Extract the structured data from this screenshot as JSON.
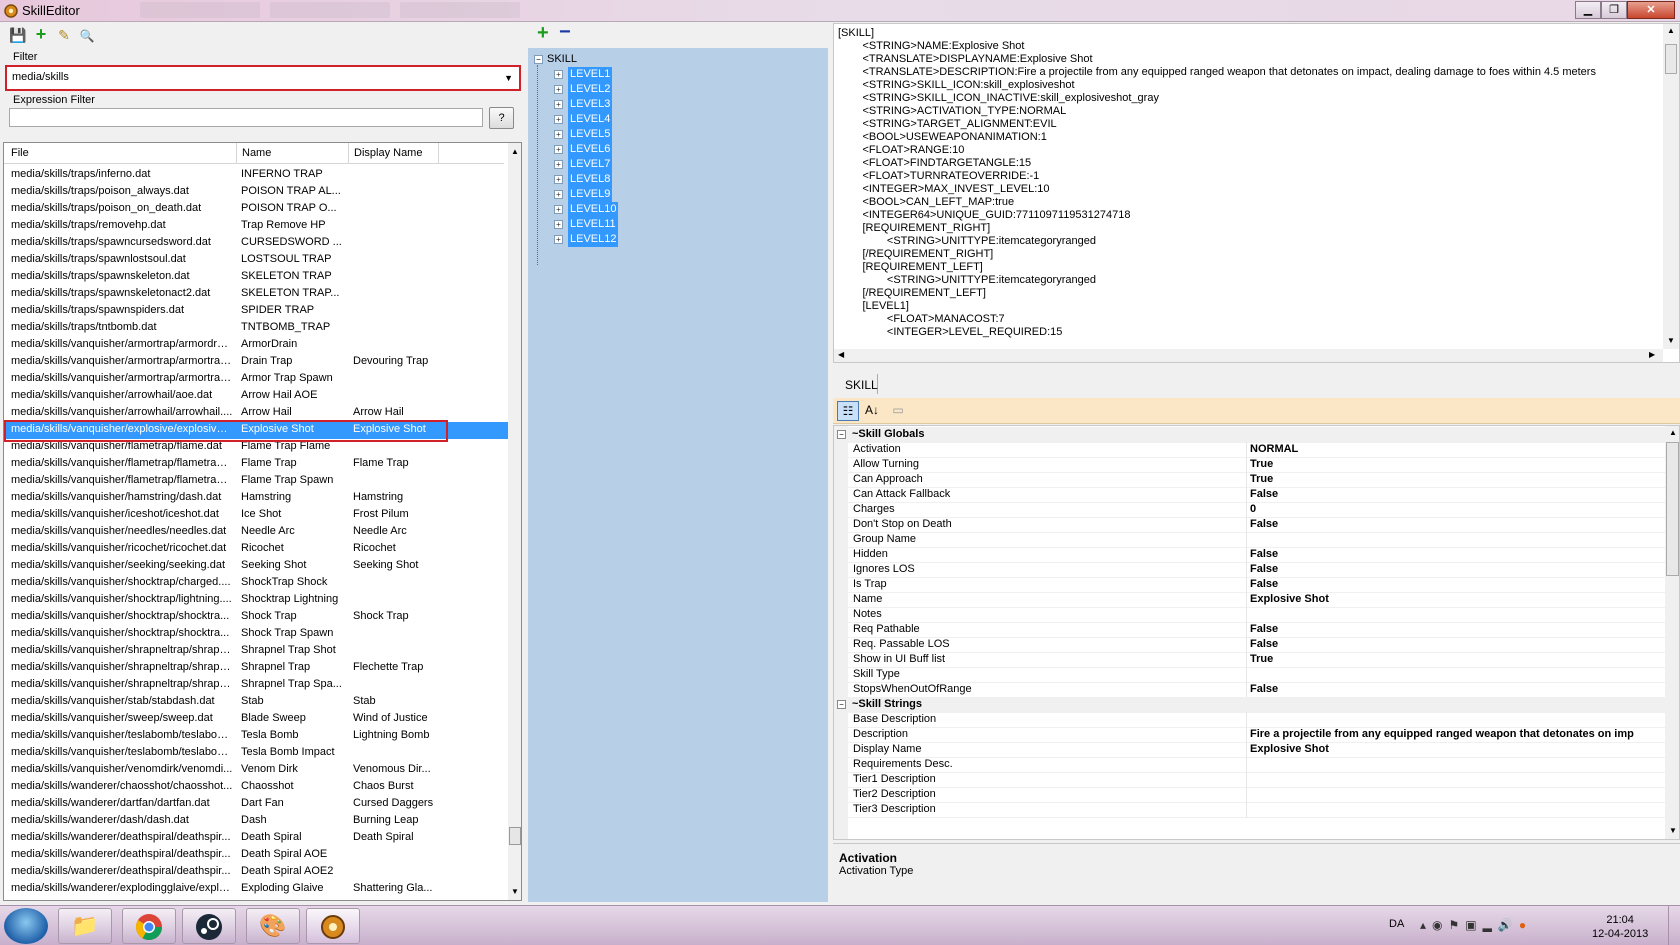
{
  "window": {
    "title": "SkillEditor",
    "controls": {
      "minimize": "▁",
      "maximize": "❐",
      "close": "✕"
    }
  },
  "toolbar": {
    "icons": [
      "save-icon",
      "add-icon",
      "edit-icon",
      "search-icon"
    ],
    "save": "💾",
    "add": "+",
    "edit": "✎",
    "search": "🔍"
  },
  "filter": {
    "label": "Filter",
    "value": "media/skills",
    "arrow": "▼"
  },
  "expression_filter": {
    "label": "Expression Filter",
    "value": "",
    "help_label": "?"
  },
  "file_list": {
    "columns": [
      "File",
      "Name",
      "Display Name"
    ],
    "selected_index": 15,
    "rows": [
      [
        "media/skills/traps/inferno.dat",
        "INFERNO TRAP",
        ""
      ],
      [
        "media/skills/traps/poison_always.dat",
        "POISON TRAP AL...",
        ""
      ],
      [
        "media/skills/traps/poison_on_death.dat",
        "POISON TRAP O...",
        ""
      ],
      [
        "media/skills/traps/removehp.dat",
        "Trap Remove HP",
        ""
      ],
      [
        "media/skills/traps/spawncursedsword.dat",
        "CURSEDSWORD ...",
        ""
      ],
      [
        "media/skills/traps/spawnlostsoul.dat",
        "LOSTSOUL TRAP",
        ""
      ],
      [
        "media/skills/traps/spawnskeleton.dat",
        "SKELETON TRAP",
        ""
      ],
      [
        "media/skills/traps/spawnskeletonact2.dat",
        "SKELETON TRAP...",
        ""
      ],
      [
        "media/skills/traps/spawnspiders.dat",
        "SPIDER TRAP",
        ""
      ],
      [
        "media/skills/traps/tntbomb.dat",
        "TNTBOMB_TRAP",
        ""
      ],
      [
        "media/skills/vanquisher/armortrap/armordrai...",
        "ArmorDrain",
        ""
      ],
      [
        "media/skills/vanquisher/armortrap/armortrap...",
        "Drain Trap",
        "Devouring Trap"
      ],
      [
        "media/skills/vanquisher/armortrap/armortrap...",
        "Armor Trap Spawn",
        ""
      ],
      [
        "media/skills/vanquisher/arrowhail/aoe.dat",
        "Arrow Hail AOE",
        ""
      ],
      [
        "media/skills/vanquisher/arrowhail/arrowhail....",
        "Arrow Hail",
        "Arrow Hail"
      ],
      [
        "media/skills/vanquisher/explosive/explosive....",
        "Explosive Shot",
        "Explosive Shot"
      ],
      [
        "media/skills/vanquisher/flametrap/flame.dat",
        "Flame Trap Flame",
        ""
      ],
      [
        "media/skills/vanquisher/flametrap/flametrap....",
        "Flame Trap",
        "Flame Trap"
      ],
      [
        "media/skills/vanquisher/flametrap/flametrap....",
        "Flame Trap Spawn",
        ""
      ],
      [
        "media/skills/vanquisher/hamstring/dash.dat",
        "Hamstring",
        "Hamstring"
      ],
      [
        "media/skills/vanquisher/iceshot/iceshot.dat",
        "Ice Shot",
        "Frost Pilum"
      ],
      [
        "media/skills/vanquisher/needles/needles.dat",
        "Needle Arc",
        "Needle Arc"
      ],
      [
        "media/skills/vanquisher/ricochet/ricochet.dat",
        "Ricochet",
        "Ricochet"
      ],
      [
        "media/skills/vanquisher/seeking/seeking.dat",
        "Seeking Shot",
        "Seeking Shot"
      ],
      [
        "media/skills/vanquisher/shocktrap/charged....",
        "ShockTrap Shock",
        ""
      ],
      [
        "media/skills/vanquisher/shocktrap/lightning....",
        "Shocktrap Lightning",
        ""
      ],
      [
        "media/skills/vanquisher/shocktrap/shocktra...",
        "Shock Trap",
        "Shock Trap"
      ],
      [
        "media/skills/vanquisher/shocktrap/shocktra...",
        "Shock Trap Spawn",
        ""
      ],
      [
        "media/skills/vanquisher/shrapneltrap/shrapn...",
        "Shrapnel Trap Shot",
        ""
      ],
      [
        "media/skills/vanquisher/shrapneltrap/shrapn...",
        "Shrapnel Trap",
        "Flechette Trap"
      ],
      [
        "media/skills/vanquisher/shrapneltrap/shrapn...",
        "Shrapnel Trap Spa...",
        ""
      ],
      [
        "media/skills/vanquisher/stab/stabdash.dat",
        "Stab",
        "Stab"
      ],
      [
        "media/skills/vanquisher/sweep/sweep.dat",
        "Blade Sweep",
        "Wind of Justice"
      ],
      [
        "media/skills/vanquisher/teslabomb/teslabom...",
        "Tesla Bomb",
        "Lightning Bomb"
      ],
      [
        "media/skills/vanquisher/teslabomb/teslabom...",
        "Tesla Bomb Impact",
        ""
      ],
      [
        "media/skills/vanquisher/venomdirk/venomdi...",
        "Venom Dirk",
        "Venomous Dir..."
      ],
      [
        "media/skills/wanderer/chaosshot/chaosshot...",
        "Chaosshot",
        "Chaos Burst"
      ],
      [
        "media/skills/wanderer/dartfan/dartfan.dat",
        "Dart Fan",
        "Cursed Daggers"
      ],
      [
        "media/skills/wanderer/dash/dash.dat",
        "Dash",
        "Burning Leap"
      ],
      [
        "media/skills/wanderer/deathspiral/deathspir...",
        "Death Spiral",
        "Death Spiral"
      ],
      [
        "media/skills/wanderer/deathspiral/deathspir...",
        "Death Spiral AOE",
        ""
      ],
      [
        "media/skills/wanderer/deathspiral/deathspir...",
        "Death Spiral AOE2",
        ""
      ],
      [
        "media/skills/wanderer/explodingglaive/explo...",
        "Exploding Glaive",
        "Shattering Gla..."
      ]
    ]
  },
  "tree": {
    "root": "SKILL",
    "nodes": [
      "LEVEL1",
      "LEVEL2",
      "LEVEL3",
      "LEVEL4",
      "LEVEL5",
      "LEVEL6",
      "LEVEL7",
      "LEVEL8",
      "LEVEL9",
      "LEVEL10",
      "LEVEL11",
      "LEVEL12"
    ],
    "add_icon": "+",
    "remove_icon": "−"
  },
  "code": {
    "lines": [
      "[SKILL]",
      "        <STRING>NAME:Explosive Shot",
      "        <TRANSLATE>DISPLAYNAME:Explosive Shot",
      "        <TRANSLATE>DESCRIPTION:Fire a projectile from any equipped ranged weapon that detonates on impact, dealing damage to foes within 4.5 meters",
      "        <STRING>SKILL_ICON:skill_explosiveshot",
      "        <STRING>SKILL_ICON_INACTIVE:skill_explosiveshot_gray",
      "        <STRING>ACTIVATION_TYPE:NORMAL",
      "        <STRING>TARGET_ALIGNMENT:EVIL",
      "        <BOOL>USEWEAPONANIMATION:1",
      "        <FLOAT>RANGE:10",
      "        <FLOAT>FINDTARGETANGLE:15",
      "        <FLOAT>TURNRATEOVERRIDE:-1",
      "        <INTEGER>MAX_INVEST_LEVEL:10",
      "        <BOOL>CAN_LEFT_MAP:true",
      "        <INTEGER64>UNIQUE_GUID:7711097119531274718",
      "        [REQUIREMENT_RIGHT]",
      "                <STRING>UNITTYPE:itemcategoryranged",
      "        [/REQUIREMENT_RIGHT]",
      "        [REQUIREMENT_LEFT]",
      "                <STRING>UNITTYPE:itemcategoryranged",
      "        [/REQUIREMENT_LEFT]",
      "        [LEVEL1]",
      "                <FLOAT>MANACOST:7",
      "                <INTEGER>LEVEL_REQUIRED:15"
    ]
  },
  "property_tab": "SKILL",
  "property_toolbar": {
    "categorized": "☷",
    "alphabetical": "A↓",
    "pages": "▭"
  },
  "properties": {
    "categories": [
      {
        "name": "~Skill Globals",
        "items": [
          [
            "Activation",
            "NORMAL"
          ],
          [
            "Allow Turning",
            "True"
          ],
          [
            "Can Approach",
            "True"
          ],
          [
            "Can Attack Fallback",
            "False"
          ],
          [
            "Charges",
            "0"
          ],
          [
            "Don't Stop on Death",
            "False"
          ],
          [
            "Group Name",
            ""
          ],
          [
            "Hidden",
            "False"
          ],
          [
            "Ignores LOS",
            "False"
          ],
          [
            "Is Trap",
            "False"
          ],
          [
            "Name",
            "Explosive Shot"
          ],
          [
            "Notes",
            ""
          ],
          [
            "Req Pathable",
            "False"
          ],
          [
            "Req. Passable LOS",
            "False"
          ],
          [
            "Show in UI Buff list",
            "True"
          ],
          [
            "Skill Type",
            ""
          ],
          [
            "StopsWhenOutOfRange",
            "False"
          ]
        ]
      },
      {
        "name": "~Skill Strings",
        "items": [
          [
            "Base Description",
            ""
          ],
          [
            "Description",
            "Fire a projectile from any equipped ranged weapon that detonates on imp"
          ],
          [
            "Display Name",
            "Explosive Shot"
          ],
          [
            "Requirements Desc.",
            ""
          ],
          [
            "Tier1 Description",
            ""
          ],
          [
            "Tier2 Description",
            ""
          ],
          [
            "Tier3 Description",
            ""
          ]
        ]
      }
    ]
  },
  "help": {
    "title": "Activation",
    "description": "Activation Type"
  },
  "taskbar": {
    "lang": "DA",
    "time": "21:04",
    "date": "12-04-2013",
    "apps": [
      "windows-start-icon",
      "explorer-icon",
      "chrome-icon",
      "steam-icon",
      "paint-icon",
      "skilleditor-icon"
    ]
  }
}
